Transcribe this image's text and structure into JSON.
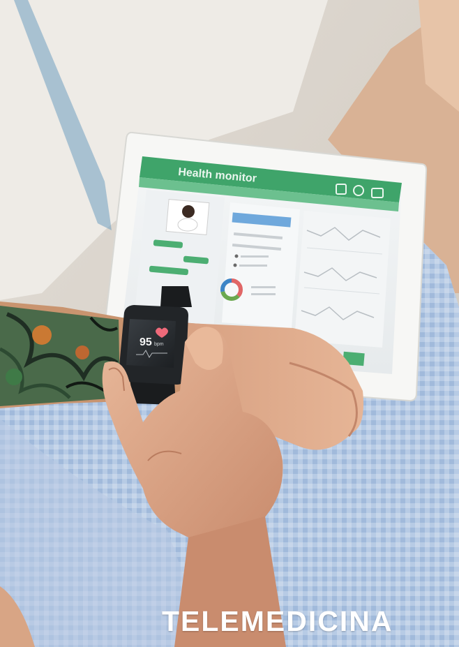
{
  "caption": "TELEMEDICINA",
  "tablet": {
    "app_title": "Health monitor",
    "icons": [
      "document-icon",
      "settings-icon",
      "calendar-icon"
    ]
  },
  "watch": {
    "heart_rate": "95",
    "unit": "bpm",
    "icon": "heart-icon"
  },
  "colors": {
    "app_green": "#3fa46a",
    "chip_blue": "#6fa8dc",
    "donut_red": "#e06666",
    "donut_green": "#6aa84f",
    "donut_blue": "#3d85c6"
  }
}
